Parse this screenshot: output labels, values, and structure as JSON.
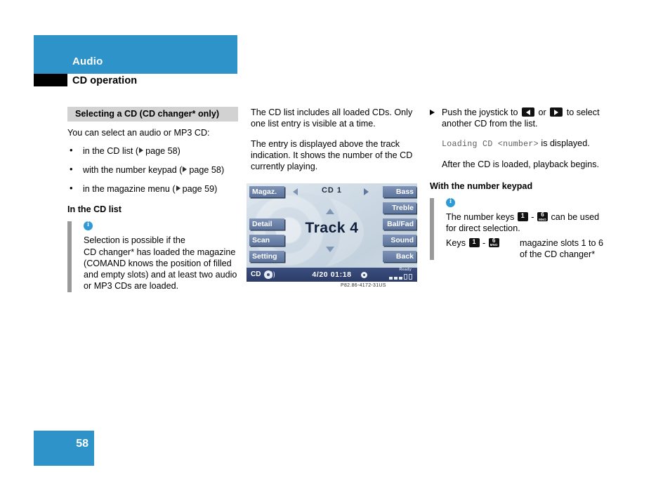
{
  "header": {
    "section": "Audio",
    "subsection": "CD operation"
  },
  "footer": {
    "page_number": "58"
  },
  "colors": {
    "brand_blue": "#2e93c8",
    "gray_heading": "#d2d2d2",
    "note_rule": "#9a9a9a",
    "info_icon": "#2e9ad6"
  },
  "col1": {
    "gray_heading": "Selecting a CD (CD changer* only)",
    "intro": "You can select an audio or MP3 CD:",
    "bullets": [
      {
        "text": "in the CD list (",
        "ref": "page 58",
        "tail": ")"
      },
      {
        "text": "with the number keypad (",
        "ref": "page 58",
        "tail": ")"
      },
      {
        "text": "in the magazine menu (",
        "ref": "page 59",
        "tail": ")"
      }
    ],
    "subheading": "In the CD list",
    "note": [
      "Selection is possible if the",
      "CD changer* has loaded the magazine",
      "(COMAND knows the position of filled",
      "and empty slots) and at least two audio",
      "or MP3 CDs are loaded."
    ]
  },
  "col2": {
    "para1": "The CD list includes all loaded CDs. Only one list entry is visible at a time.",
    "para2": "The entry is displayed above the track indication. It shows the number of the CD currently playing.",
    "figure_caption": "P82.86-4172-31US"
  },
  "display": {
    "left_buttons": [
      "Magaz.",
      "Detail",
      "Scan",
      "Setting"
    ],
    "right_buttons": [
      "Bass",
      "Treble",
      "Bal/Fad",
      "Sound",
      "Back"
    ],
    "cd_label": "CD 1",
    "track_label": "Track 4",
    "status_source": "CD",
    "status_time": "4/20  01:18",
    "status_ready": "Ready",
    "magazine_slots": [
      "filled",
      "filled",
      "filled",
      "empty",
      "empty"
    ]
  },
  "col3": {
    "step1_a": "Push the joystick to",
    "step1_or": "or",
    "step1_b": "to select another CD from the list.",
    "loading_mono": "Loading CD <number>",
    "loading_tail": " is displayed.",
    "after_load": "After the CD is loaded, playback begins.",
    "subheading": "With the number keypad",
    "note_a": "The number keys",
    "note_dash": "-",
    "note_b": "can be used for direct selection.",
    "keys_label": "Keys",
    "key_low": "1",
    "key_high": "6",
    "key_high_sub": "MNO",
    "keys_desc": [
      "magazine slots 1 to 6",
      "of the CD changer*"
    ]
  }
}
